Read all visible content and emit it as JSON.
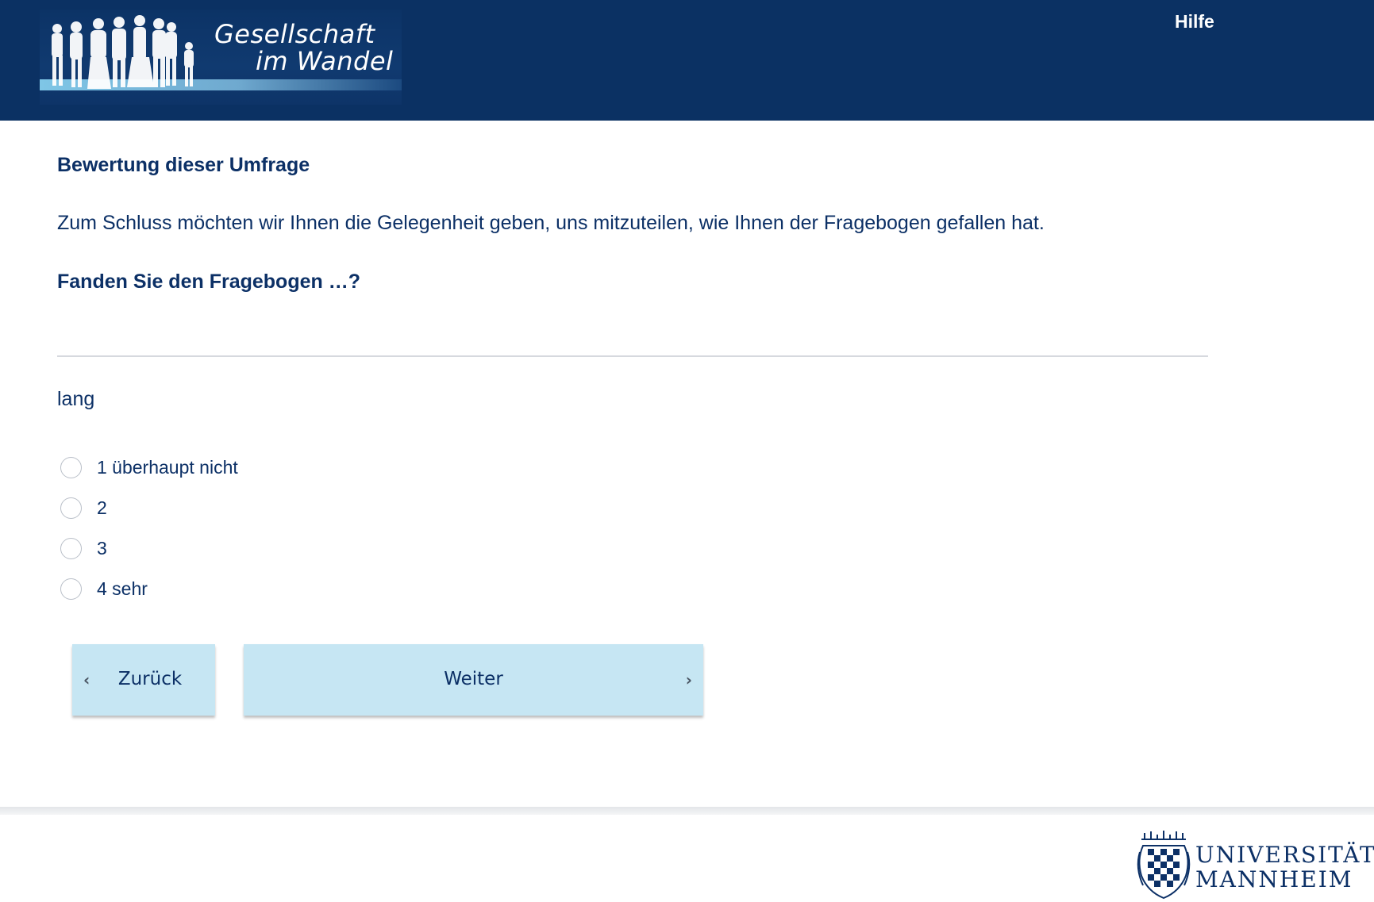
{
  "header": {
    "logo_line1": "Gesellschaft",
    "logo_line2": "im Wandel",
    "help_label": "Hilfe",
    "background_color": "#0b3163"
  },
  "content": {
    "section_title": "Bewertung dieser Umfrage",
    "intro": "Zum Schluss möchten wir Ihnen die Gelegenheit geben, uns mitzuteilen, wie Ihnen der Fragebogen gefallen hat.",
    "question": "Fanden Sie den Fragebogen …?",
    "item_label": "lang",
    "options": [
      {
        "label": "1 überhaupt nicht",
        "selected": false
      },
      {
        "label": "2",
        "selected": false
      },
      {
        "label": "3",
        "selected": false
      },
      {
        "label": "4 sehr",
        "selected": false
      }
    ]
  },
  "navigation": {
    "back_label": "Zurück",
    "back_icon": "chevron-left-icon",
    "next_label": "Weiter",
    "next_icon": "chevron-right-icon",
    "button_color": "#c6e6f3"
  },
  "footer": {
    "university_line1": "UNIVERSITÄT",
    "university_line2": "MANNHEIM",
    "crest_icon": "university-crest-icon"
  }
}
